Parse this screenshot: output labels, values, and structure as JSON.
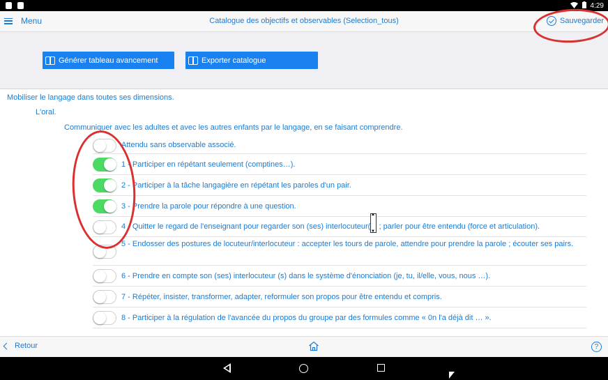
{
  "status_bar": {
    "time": "4:29"
  },
  "header": {
    "menu_label": "Menu",
    "title": "Catalogue des objectifs et observables (Selection_tous)",
    "save_label": "Sauvegarder"
  },
  "toolbar": {
    "generate_label": "Générer tableau avancement",
    "export_label": "Exporter catalogue"
  },
  "content": {
    "level1": "Mobiliser le langage dans toutes ses dimensions.",
    "level2": "L'oral.",
    "level3": "Communiquer avec les adultes et avec les autres enfants par le langage, en se faisant comprendre.",
    "items": [
      {
        "label": "Attendu sans observable associé.",
        "on": false
      },
      {
        "label": "1 - Participer en répétant seulement (comptines…).",
        "on": true
      },
      {
        "label": "2 - Participer à la tâche langagière en répétant les paroles d'un pair.",
        "on": true
      },
      {
        "label": "3 - Prendre la parole pour répondre à une question.",
        "on": true
      },
      {
        "label": "4 - Quitter le regard de l'enseignant pour regarder son (ses) interlocuteur(s) ; parler pour être entendu (force et articulation).",
        "on": false
      },
      {
        "label": "5 - Endosser des postures de locuteur/interlocuteur : accepter les tours de parole, attendre pour prendre la parole ; écouter ses pairs.",
        "on": false
      },
      {
        "label": "6 - Prendre en compte son (ses) interlocuteur (s) dans le système d'énonciation (je, tu, il/elle, vous, nous …).",
        "on": false
      },
      {
        "label": "7 - Répéter, insister, transformer, adapter, reformuler son propos pour être entendu et compris.",
        "on": false
      },
      {
        "label": "8 - Participer à la régulation de l'avancée du propos du groupe par des formules comme « 0n l'a déjà dit … ».",
        "on": false
      }
    ]
  },
  "bottom_bar": {
    "back_label": "Retour",
    "help_label": "?"
  },
  "colors": {
    "accent": "#1a7bd4",
    "button": "#1a82f0",
    "toggle_on": "#4cd964",
    "annotation": "#d93030"
  }
}
